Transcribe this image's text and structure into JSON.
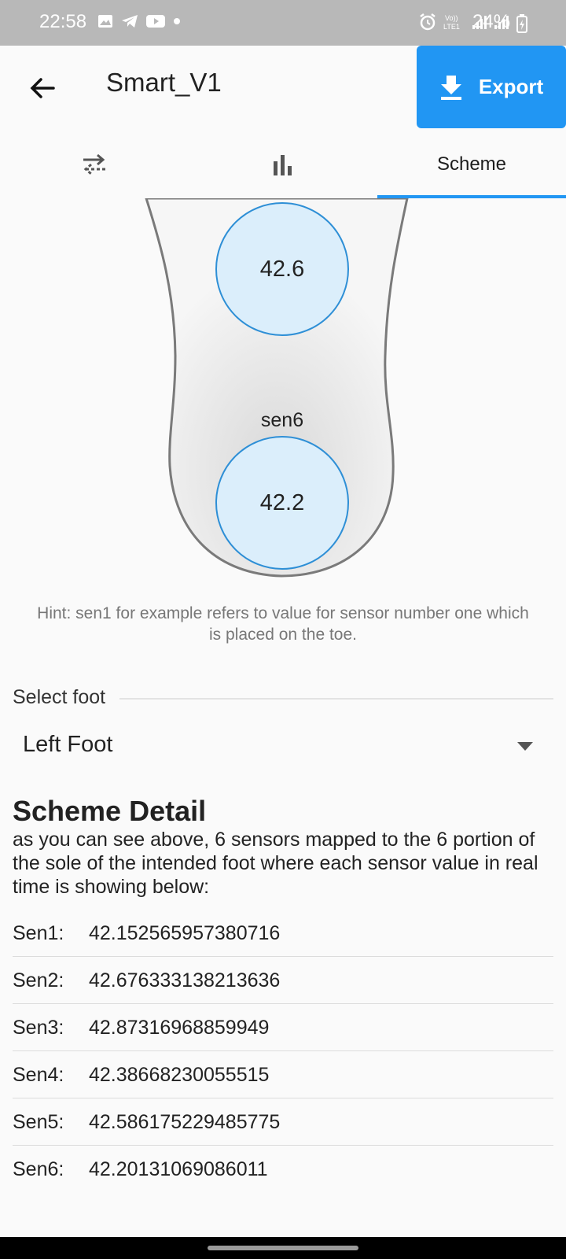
{
  "status_bar": {
    "time": "22:58",
    "battery": "24%",
    "icons_left": [
      "image-icon",
      "telegram-icon",
      "youtube-icon",
      "dot-icon"
    ],
    "icons_right": [
      "alarm-icon",
      "volte-icon",
      "signal-icon",
      "signal-icon",
      "battery-icon"
    ]
  },
  "app_bar": {
    "title": "Smart_V1",
    "export_label": "Export"
  },
  "tabs": {
    "items": [
      {
        "icon": "swap-arrows-icon",
        "label": ""
      },
      {
        "icon": "bar-chart-icon",
        "label": ""
      },
      {
        "icon": "",
        "label": "Scheme"
      }
    ],
    "active_index": 2
  },
  "foot": {
    "sensors": [
      {
        "value": "42.6"
      },
      {
        "label": "sen6",
        "value": "42.2"
      }
    ]
  },
  "hint": "Hint: sen1 for example refers to value for sensor number one which is placed on the toe.",
  "select_foot": {
    "label": "Select foot",
    "value": "Left Foot"
  },
  "scheme_detail": {
    "title": "Scheme Detail",
    "description": "as you can see above, 6 sensors mapped to the 6 portion of the sole of the intended foot where each sensor value in real time is showing below:",
    "rows": [
      {
        "name": "Sen1:",
        "value": "42.152565957380716"
      },
      {
        "name": "Sen2:",
        "value": "42.676333138213636"
      },
      {
        "name": "Sen3:",
        "value": "42.87316968859949"
      },
      {
        "name": "Sen4:",
        "value": "42.38668230055515"
      },
      {
        "name": "Sen5:",
        "value": "42.586175229485775"
      },
      {
        "name": "Sen6:",
        "value": "42.20131069086011"
      }
    ]
  },
  "colors": {
    "accent": "#2196f3",
    "sensor_fill": "#dbeefb",
    "sensor_border": "#2e8fd6"
  }
}
